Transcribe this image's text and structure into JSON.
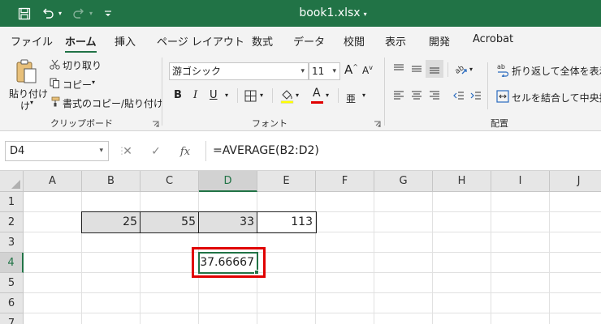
{
  "titlebar": {
    "title": "book1.xlsx",
    "title_caret": "▾",
    "colors": {
      "background": "#217346",
      "foreground": "#ffffff"
    },
    "icons": [
      "save-icon",
      "undo-icon",
      "redo-icon",
      "customize-qat-icon"
    ]
  },
  "tabs": [
    {
      "label": "ファイル",
      "active": false
    },
    {
      "label": "ホーム",
      "active": true
    },
    {
      "label": "挿入",
      "active": false
    },
    {
      "label": "ページ レイアウト",
      "active": false
    },
    {
      "label": "数式",
      "active": false
    },
    {
      "label": "データ",
      "active": false
    },
    {
      "label": "校閲",
      "active": false
    },
    {
      "label": "表示",
      "active": false
    },
    {
      "label": "開発",
      "active": false
    },
    {
      "label": "Acrobat",
      "active": false
    }
  ],
  "ribbon": {
    "clipboard": {
      "paste_label_line1": "貼り付け",
      "paste_label_line2": "け",
      "cut_label": "切り取り",
      "copy_label": "コピー",
      "format_painter_label": "書式のコピー/貼り付け",
      "group_label": "クリップボード"
    },
    "font": {
      "font_name": "游ゴシック",
      "font_size": "11",
      "group_label": "フォント",
      "font_color": "#e00000",
      "increase_size_label": "A",
      "decrease_size_label": "A",
      "bold_label": "B",
      "italic_label": "I",
      "underline_label": "U",
      "font_color_label": "A",
      "phonetic_label": "亜"
    },
    "alignment": {
      "wrap_text_label": "折り返して全体を表示す",
      "merge_center_label": "セルを結合して中央揃え",
      "group_label": "配置"
    }
  },
  "formula_bar": {
    "name_box": "D4",
    "cancel_icon": "✕",
    "enter_icon": "✓",
    "fx_label": "fx",
    "formula": "=AVERAGE(B2:D2)"
  },
  "sheet": {
    "columns": [
      "A",
      "B",
      "C",
      "D",
      "E",
      "F",
      "G",
      "H",
      "I",
      "J"
    ],
    "rows": [
      "1",
      "2",
      "3",
      "4",
      "5",
      "6",
      "7"
    ],
    "selected_cell": "D4",
    "cells": {
      "B2": "25",
      "C2": "55",
      "D2": "33",
      "E2": "113",
      "D4": "37.66667"
    },
    "accent_color": "#217346",
    "highlight_color": "#e00000"
  }
}
